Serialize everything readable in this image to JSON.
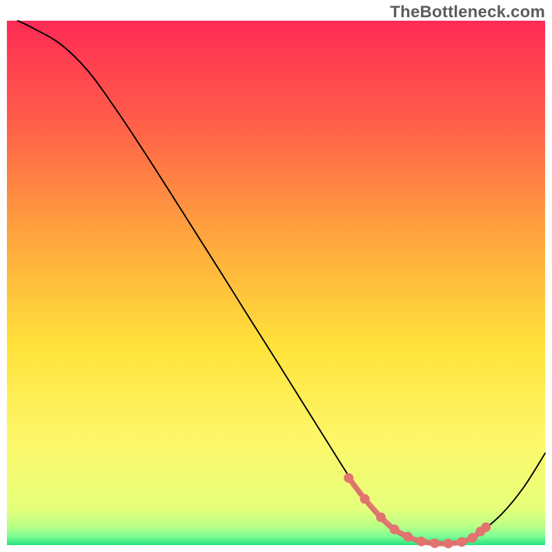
{
  "watermark": "TheBottleneck.com",
  "chart_data": {
    "type": "line",
    "title": "",
    "xlabel": "",
    "ylabel": "",
    "xlim": [
      0,
      100
    ],
    "ylim": [
      0,
      100
    ],
    "grid": false,
    "legend": false,
    "background": {
      "type": "vertical-gradient",
      "stops": [
        {
          "offset": 0.0,
          "color": "#ff2b55"
        },
        {
          "offset": 0.18,
          "color": "#ff5a4a"
        },
        {
          "offset": 0.4,
          "color": "#ffa23e"
        },
        {
          "offset": 0.62,
          "color": "#ffe23a"
        },
        {
          "offset": 0.8,
          "color": "#fdf76a"
        },
        {
          "offset": 0.93,
          "color": "#e6ff7a"
        },
        {
          "offset": 0.965,
          "color": "#b8ff86"
        },
        {
          "offset": 0.983,
          "color": "#7dff95"
        },
        {
          "offset": 1.0,
          "color": "#28e27e"
        }
      ]
    },
    "series": [
      {
        "name": "bottleneck-curve",
        "color": "#000000",
        "stroke_width": 2,
        "x": [
          2,
          5,
          10,
          15,
          20,
          25,
          30,
          35,
          40,
          45,
          50,
          55,
          60,
          63,
          66,
          70,
          74,
          78,
          82,
          85,
          88,
          92,
          96,
          100
        ],
        "y": [
          100,
          98.5,
          95.5,
          90.5,
          83.5,
          75.8,
          67.8,
          59.7,
          51.6,
          43.4,
          35.3,
          27.1,
          18.9,
          14.0,
          9.3,
          4.3,
          1.4,
          0.4,
          0.3,
          0.8,
          2.5,
          6.0,
          11.0,
          17.5
        ]
      },
      {
        "name": "optimal-region-dots",
        "color": "#e2736f",
        "type": "scatter",
        "marker": "dot",
        "marker_size": 7,
        "stroke_width": 8,
        "x": [
          63.5,
          66.5,
          69.5,
          72.0,
          74.5,
          77.0,
          79.5,
          82.0,
          84.5,
          86.5,
          88.0,
          89.0
        ],
        "y": [
          12.8,
          8.8,
          5.3,
          3.0,
          1.6,
          0.7,
          0.35,
          0.3,
          0.6,
          1.4,
          2.6,
          3.4
        ]
      }
    ]
  }
}
